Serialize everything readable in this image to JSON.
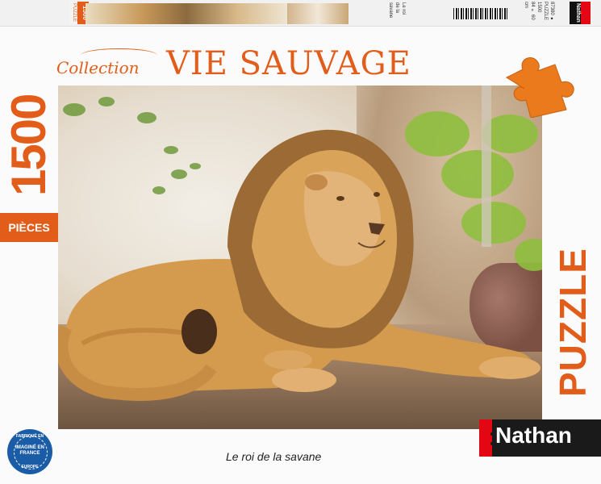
{
  "edge": {
    "count": "1500",
    "count_label": "PUZZLE",
    "subtitle_line1": "Le roi",
    "subtitle_line2": "de la savane",
    "info_line1": "87380 ● PUZZLE 1500",
    "info_line2": "84 × 60 cm",
    "brand": "Nathan"
  },
  "header": {
    "collection": "Collection",
    "title": "VIE SAUVAGE"
  },
  "left": {
    "count": "1500",
    "pieces_label": "PIÈCES"
  },
  "right": {
    "puzzle_label": "PUZZLE"
  },
  "footer": {
    "subtitle": "Le roi de la savane",
    "seal_top": "FABRIQUÉ EN",
    "seal_mid": "IMAGINÉ EN FRANCE",
    "seal_bot": "EUROPE",
    "brand": "Nathan"
  },
  "colors": {
    "accent": "#e25d1a",
    "brand_bg": "#1a1a1a",
    "brand_red": "#e30613",
    "seal_blue": "#1b5ca6"
  }
}
